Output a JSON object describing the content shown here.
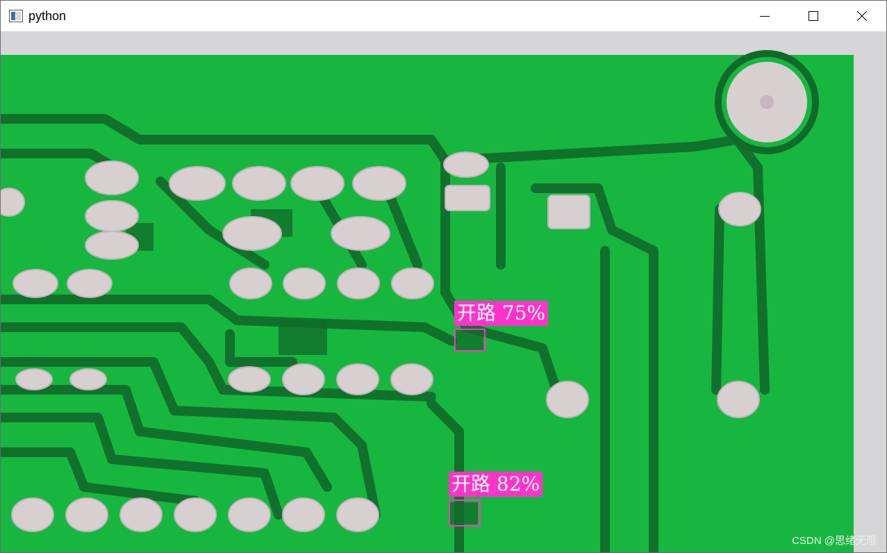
{
  "window": {
    "title": "python",
    "icon": "python-app-icon",
    "controls": [
      "minimize-icon",
      "maximize-icon",
      "close-icon"
    ]
  },
  "image": {
    "board_color": "#17b73f",
    "trace_color": "#116a2a",
    "pad_color": "#d8d0d0",
    "background_color": "#d6d6d8"
  },
  "detections": [
    {
      "label": "开路 75%",
      "class": "开路",
      "confidence": "75%",
      "color": "#ff33cc"
    },
    {
      "label": "开路 82%",
      "class": "开路",
      "confidence": "82%",
      "color": "#ff33cc"
    }
  ],
  "watermark": "CSDN @思绪无限"
}
